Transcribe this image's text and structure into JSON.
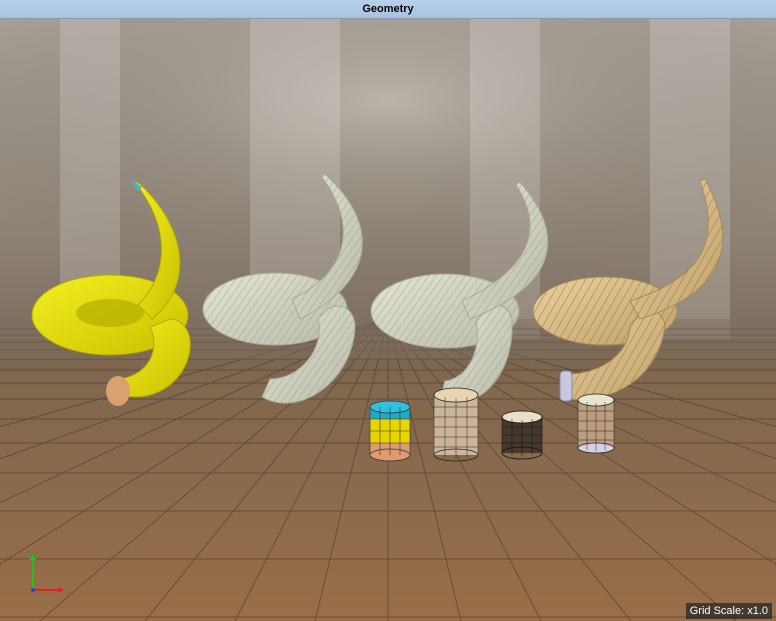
{
  "window": {
    "title": "Geometry"
  },
  "viewport": {
    "grid_scale": "Grid Scale: x1.0",
    "objects": [
      {
        "name": "horn-1",
        "style": "smooth-yellow"
      },
      {
        "name": "horn-2",
        "style": "ridged-gray"
      },
      {
        "name": "horn-3",
        "style": "ridged-gray"
      },
      {
        "name": "horn-4",
        "style": "ridged-tan"
      }
    ],
    "primitives": [
      {
        "name": "cylinder-colored"
      },
      {
        "name": "cylinder-wire-1"
      },
      {
        "name": "cylinder-wire-2"
      },
      {
        "name": "cylinder-wire-3"
      }
    ],
    "axis_gizmo": {
      "x_color": "#e02020",
      "y_color": "#20c020"
    }
  },
  "colors": {
    "titlebar": "#b9d1ea",
    "floor": "#8a6a4e",
    "horn_yellow": "#e6e000",
    "horn_gray": "#d8d9c8",
    "horn_tan": "#d9c090"
  }
}
